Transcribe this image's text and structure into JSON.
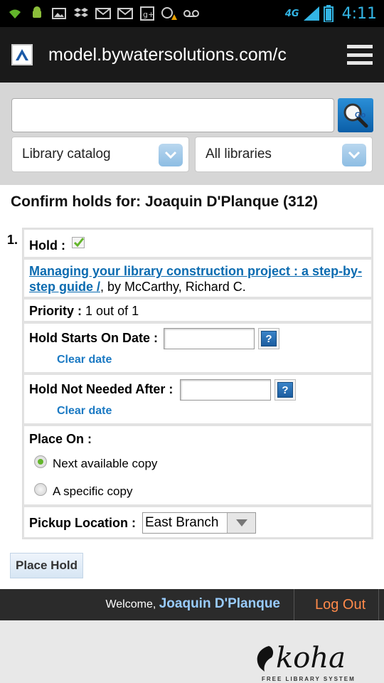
{
  "status_bar": {
    "network": "4G",
    "time": "4:11"
  },
  "browser": {
    "url": "model.bywatersolutions.com/c"
  },
  "search": {
    "query": "",
    "catalog_select": "Library catalog",
    "library_select": "All libraries"
  },
  "page": {
    "heading": "Confirm holds for: Joaquin D'Planque (312)"
  },
  "hold": {
    "number": "1.",
    "hold_label": "Hold :",
    "title_link": "Managing your library construction project : a step-by-step guide /",
    "author": ", by McCarthy, Richard C.",
    "priority_label": "Priority :",
    "priority_value": "1 out of 1",
    "starts_label": "Hold Starts On Date :",
    "clear_date": "Clear date",
    "not_needed_label": "Hold Not Needed After :",
    "place_on_label": "Place On :",
    "option_next": "Next available copy",
    "option_specific": "A specific copy",
    "pickup_label": "Pickup Location :",
    "pickup_value": "East Branch",
    "help_glyph": "?"
  },
  "actions": {
    "place_hold": "Place Hold"
  },
  "footer": {
    "welcome": "Welcome, ",
    "user": "Joaquin D'Planque",
    "logout": "Log Out"
  },
  "branding": {
    "logo_text": "koha",
    "tagline": "FREE LIBRARY SYSTEM"
  }
}
